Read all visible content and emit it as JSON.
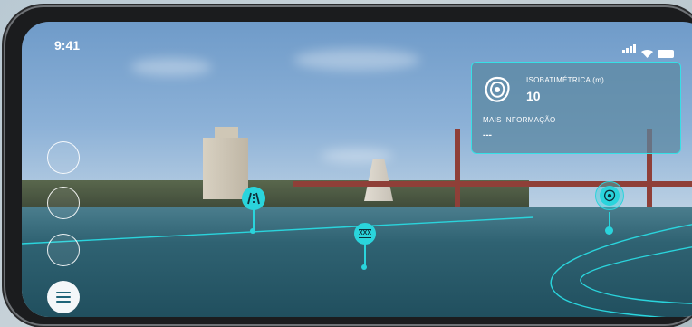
{
  "status_bar": {
    "time": "9:41"
  },
  "info_card": {
    "title": "ISOBATIMÉTRICA (m)",
    "value": "10",
    "more_label": "MAIS INFORMAÇÃO",
    "more_value": "---"
  },
  "markers": [
    {
      "name": "navigation-channel",
      "icon": "channel-lines-icon"
    },
    {
      "name": "prohibited-zone",
      "icon": "xxx-icon",
      "label": "XXX"
    },
    {
      "name": "isobath",
      "icon": "isobath-contour-icon"
    }
  ],
  "side_buttons": [
    "layer-toggle-1",
    "layer-toggle-2",
    "layer-toggle-3"
  ],
  "colors": {
    "accent": "#2ad4dc",
    "card_border": "#37e0e6",
    "card_bg": "#5a87a0"
  }
}
